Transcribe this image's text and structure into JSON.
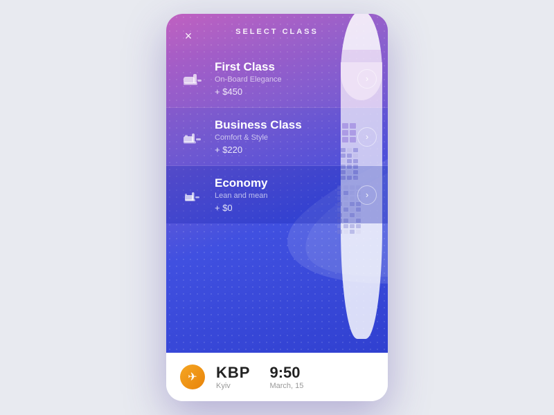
{
  "header": {
    "title": "SELECT CLASS",
    "close_label": "×"
  },
  "classes": [
    {
      "id": "first",
      "name": "First Class",
      "subtitle": "On-Board Elegance",
      "price": "+ $450",
      "arrow": "›",
      "icon": "first-seat"
    },
    {
      "id": "business",
      "name": "Business Class",
      "subtitle": "Comfort & Style",
      "price": "+ $220",
      "arrow": "›",
      "icon": "business-seat"
    },
    {
      "id": "economy",
      "name": "Economy",
      "subtitle": "Lean and mean",
      "price": "+ $0",
      "arrow": "›",
      "icon": "economy-seat"
    }
  ],
  "footer": {
    "airline_logo": "✈",
    "airport_code": "KBP",
    "city": "Kyiv",
    "time": "9:50",
    "date": "March, 15"
  },
  "colors": {
    "gradient_start": "#c060c0",
    "gradient_mid": "#6050d8",
    "gradient_end": "#3040d0",
    "white": "#ffffff",
    "footer_bg": "#ffffff"
  }
}
